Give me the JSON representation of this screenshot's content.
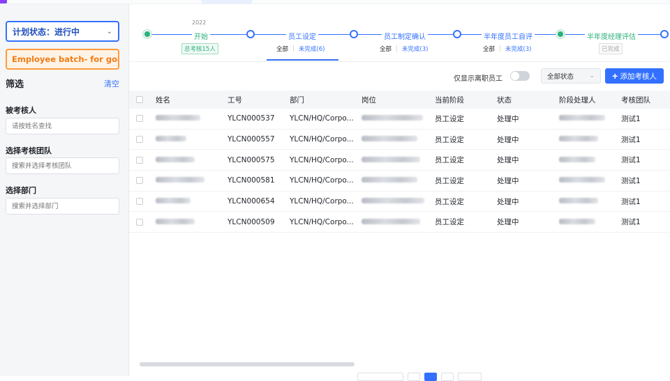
{
  "sidebar": {
    "plan_status": "计划状态：进行中",
    "batch": "Employee batch- for goal m",
    "filter_title": "筛选",
    "clear": "清空",
    "reviewee_label": "被考核人",
    "reviewee_placeholder": "请按姓名查找",
    "team_label": "选择考核团队",
    "team_placeholder": "搜索并选择考核团队",
    "dept_label": "选择部门",
    "dept_placeholder": "搜索并选择部门"
  },
  "stepper": {
    "year": "2022",
    "steps": [
      {
        "name": "开始",
        "badge": "总考核15人"
      },
      {
        "name": "员工设定",
        "all": "全部",
        "undone": "未完成(6)"
      },
      {
        "name": "员工制定确认",
        "all": "全部",
        "undone": "未完成(3)"
      },
      {
        "name": "半年度员工自评",
        "all": "全部",
        "undone": "未完成(3)"
      },
      {
        "name": "半年度经理评估",
        "badge": "已完成"
      }
    ]
  },
  "toolbar": {
    "only_left": "仅显示离职员工",
    "status_select": "全部状态",
    "add_button": "添加考核人"
  },
  "table": {
    "headers": [
      "姓名",
      "工号",
      "部门",
      "岗位",
      "当前阶段",
      "状态",
      "阶段处理人",
      "考核团队"
    ],
    "rows": [
      {
        "id": "YLCN000537",
        "dept": "YLCN/HQ/Corpo...",
        "stage": "员工设定",
        "status": "处理中",
        "team": "测试1"
      },
      {
        "id": "YLCN000557",
        "dept": "YLCN/HQ/Corpo...",
        "stage": "员工设定",
        "status": "处理中",
        "team": "测试1"
      },
      {
        "id": "YLCN000575",
        "dept": "YLCN/HQ/Corpo...",
        "stage": "员工设定",
        "status": "处理中",
        "team": "测试1"
      },
      {
        "id": "YLCN000581",
        "dept": "YLCN/HQ/Corpo...",
        "stage": "员工设定",
        "status": "处理中",
        "team": "测试1"
      },
      {
        "id": "YLCN000654",
        "dept": "YLCN/HQ/Corpo...",
        "stage": "员工设定",
        "status": "处理中",
        "team": "测试1"
      },
      {
        "id": "YLCN000509",
        "dept": "YLCN/HQ/Corpo...",
        "stage": "员工设定",
        "status": "处理中",
        "team": "测试1"
      }
    ]
  },
  "colors": {
    "accent": "#3370ff",
    "done": "#2db07c",
    "batch": "#f07c14"
  }
}
